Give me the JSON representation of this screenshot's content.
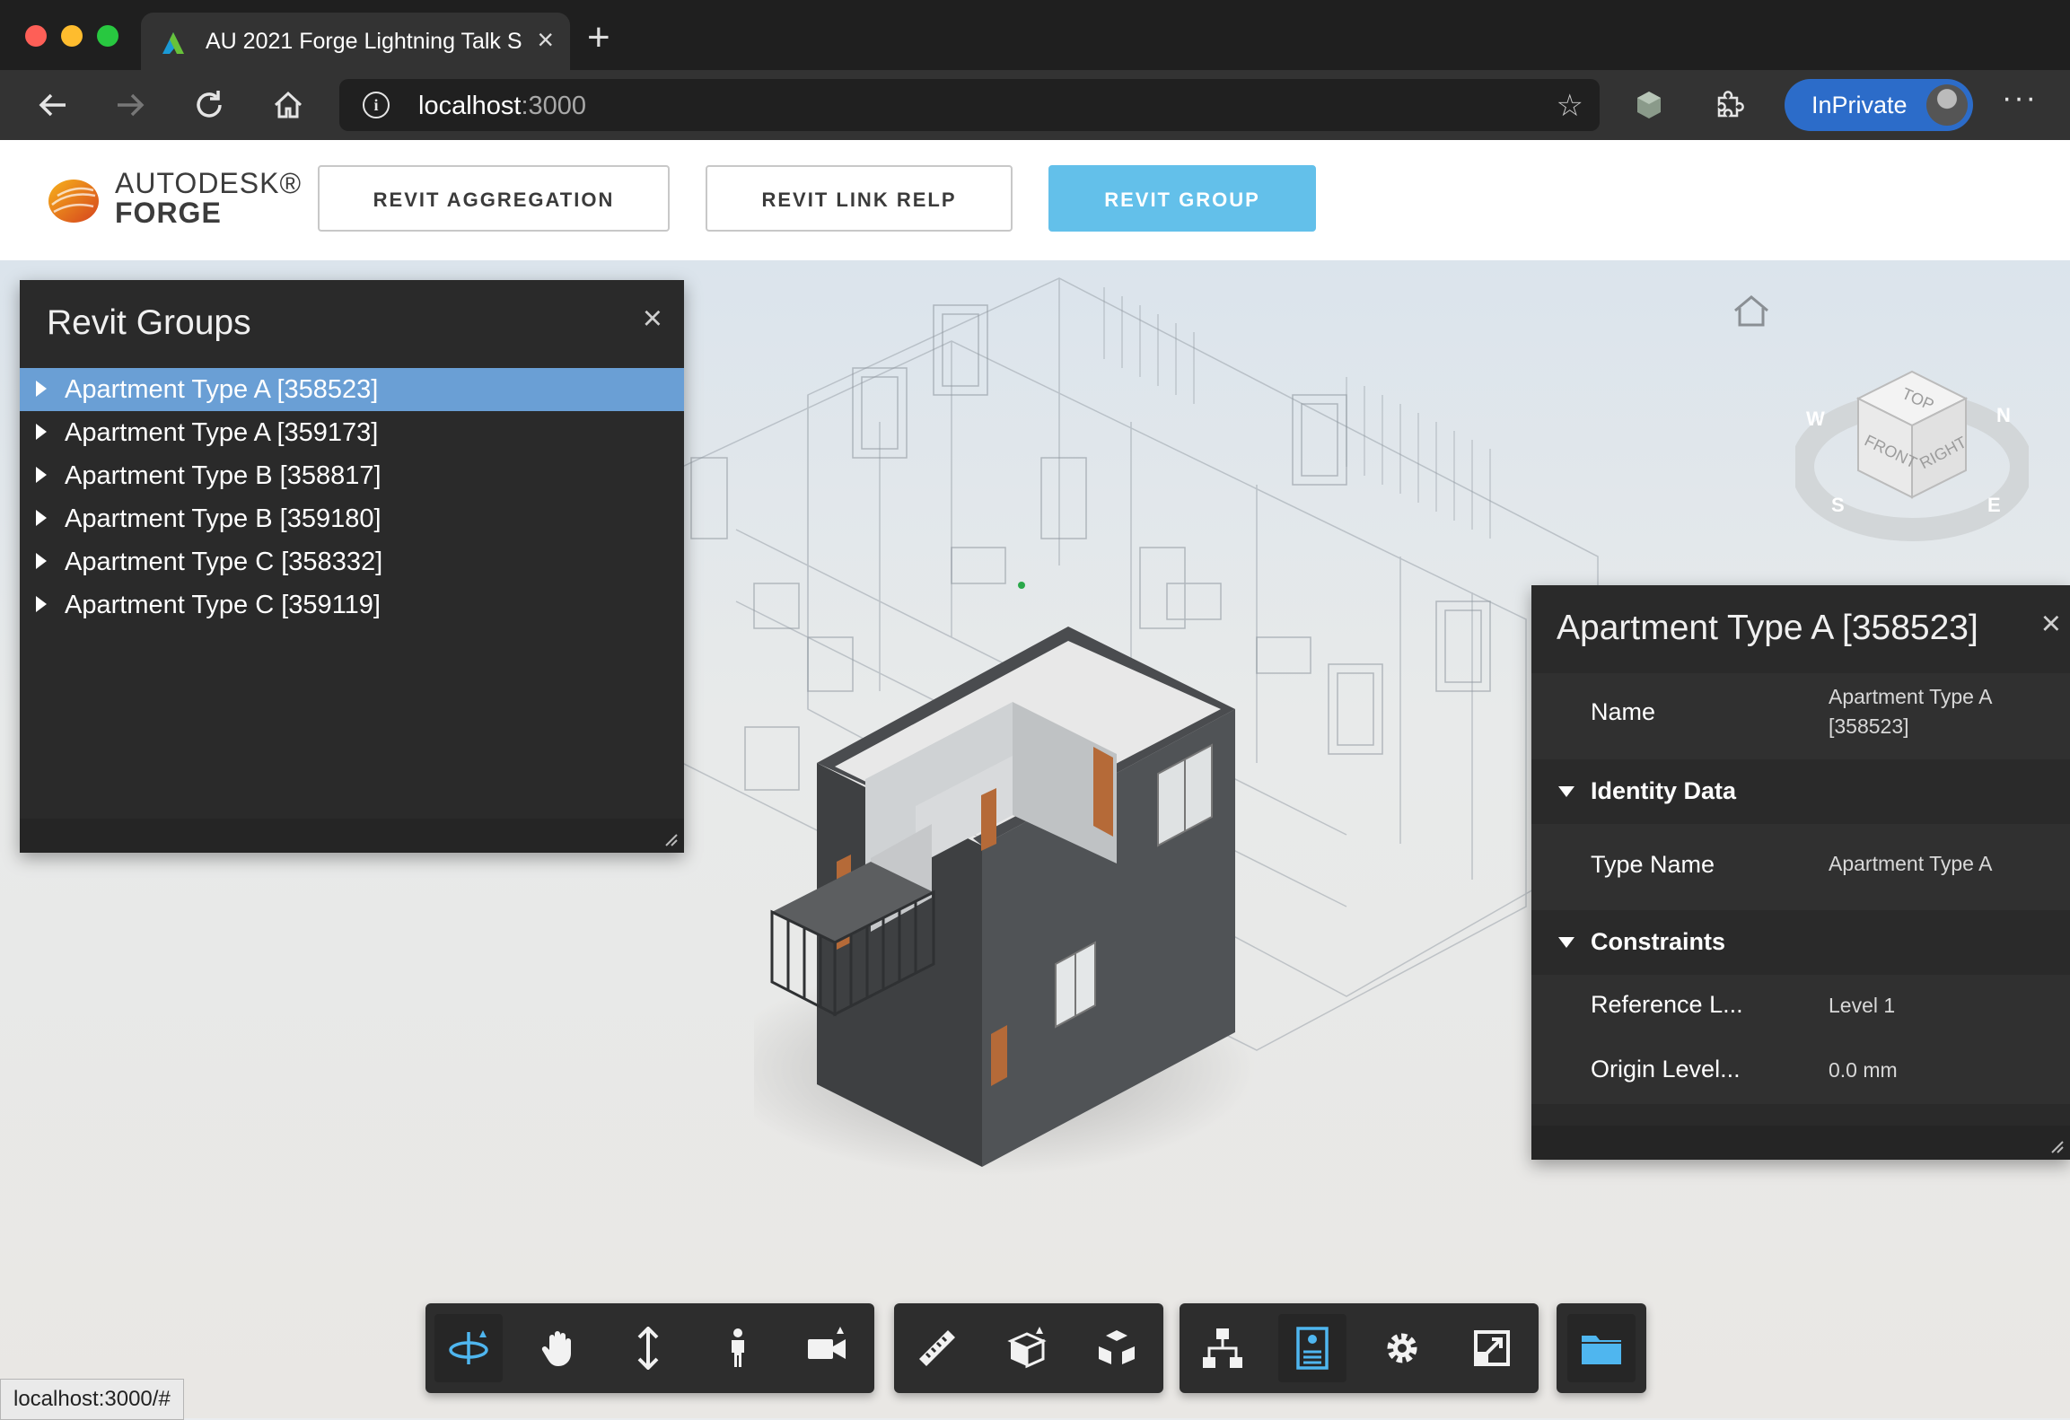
{
  "browser": {
    "tab_title": "AU 2021 Forge Lightning Talk S",
    "url_host": "localhost",
    "url_port": ":3000",
    "profile_label": "InPrivate"
  },
  "header": {
    "brand_line1": "AUTODESK®",
    "brand_line2": "FORGE",
    "buttons": [
      "REVIT AGGREGATION",
      "REVIT LINK RELP",
      "REVIT GROUP"
    ],
    "active_button": "REVIT GROUP"
  },
  "groups_panel": {
    "title": "Revit Groups",
    "items": [
      {
        "label": "Apartment Type A [358523]",
        "selected": true
      },
      {
        "label": "Apartment Type A [359173]",
        "selected": false
      },
      {
        "label": "Apartment Type B [358817]",
        "selected": false
      },
      {
        "label": "Apartment Type B [359180]",
        "selected": false
      },
      {
        "label": "Apartment Type C [358332]",
        "selected": false
      },
      {
        "label": "Apartment Type C [359119]",
        "selected": false
      }
    ]
  },
  "properties_panel": {
    "title": "Apartment Type A [358523]",
    "name_key": "Name",
    "name_value": "Apartment Type A [358523]",
    "categories": [
      {
        "name": "Identity Data",
        "rows": [
          {
            "key": "Type Name",
            "value": "Apartment Type A"
          }
        ]
      },
      {
        "name": "Constraints",
        "rows": [
          {
            "key": "Reference L...",
            "value": "Level 1"
          },
          {
            "key": "Origin Level...",
            "value": "0.0 mm"
          }
        ]
      }
    ]
  },
  "viewcube": {
    "top": "TOP",
    "front": "FRONT",
    "right": "RIGHT",
    "n": "N",
    "s": "S",
    "e": "E",
    "w": "W"
  },
  "toolbar_icons": [
    "orbit-icon",
    "pan-icon",
    "zoom-icon",
    "first-person-icon",
    "camera-icon",
    "measure-icon",
    "section-icon",
    "explode-icon",
    "model-browser-icon",
    "properties-icon",
    "settings-icon",
    "fullscreen-icon",
    "document-browser-icon"
  ],
  "status_bar": "localhost:3000/#",
  "colors": {
    "selected_row": "#6a9fd5",
    "active_button": "#63c0ea",
    "inprivate": "#2c6cc9",
    "active_tool": "#4fb6ef"
  }
}
